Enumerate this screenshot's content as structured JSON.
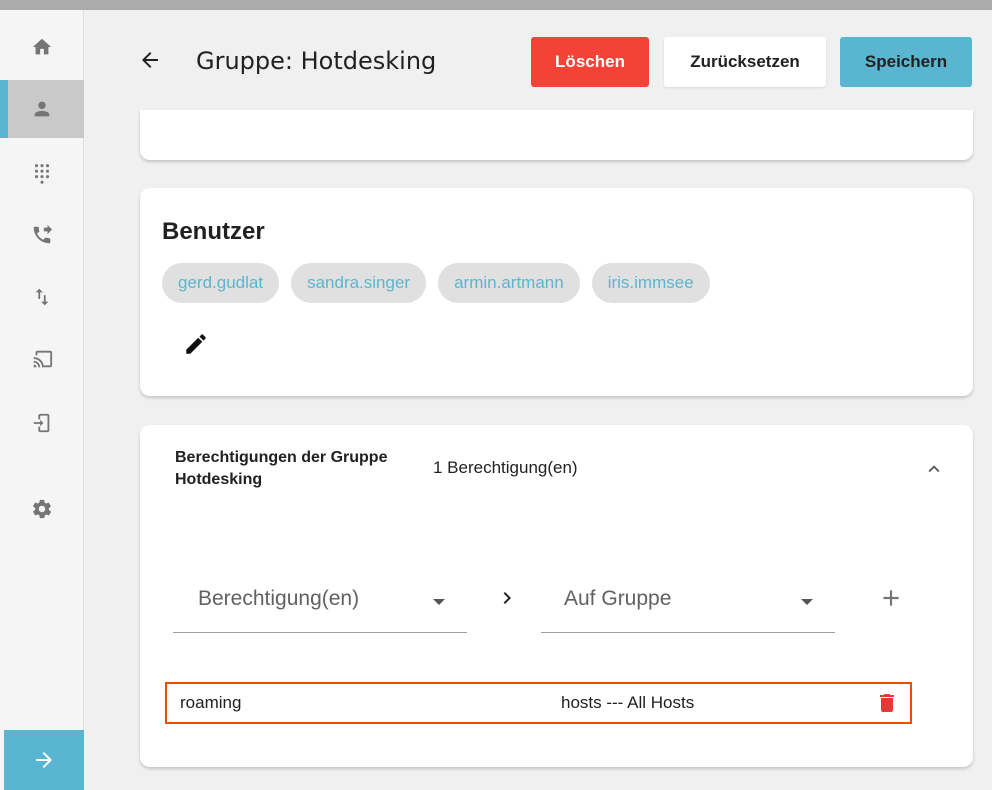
{
  "colors": {
    "accent": "#5ab6d0",
    "danger": "#f44336",
    "highlight": "#e65100"
  },
  "sidebar": {
    "items": [
      {
        "icon": "home-icon"
      },
      {
        "icon": "person-icon",
        "active": true
      },
      {
        "icon": "dialpad-icon"
      },
      {
        "icon": "phone-forward-icon"
      },
      {
        "icon": "swap-vert-icon"
      },
      {
        "icon": "cast-icon"
      },
      {
        "icon": "login-icon"
      },
      {
        "icon": "settings-icon"
      }
    ],
    "expand_icon": "arrow-right-icon"
  },
  "header": {
    "title": "Gruppe: Hotdesking",
    "delete_label": "Löschen",
    "reset_label": "Zurücksetzen",
    "save_label": "Speichern"
  },
  "users": {
    "title": "Benutzer",
    "chips": [
      "gerd.gudlat",
      "sandra.singer",
      "armin.artmann",
      "iris.immsee"
    ]
  },
  "permissions": {
    "title": "Berechtigungen der Gruppe Hotdesking",
    "count": "1 Berechtigung(en)",
    "permission_select": "Berechtigung(en)",
    "group_select": "Auf Gruppe",
    "rows": [
      {
        "name": "roaming",
        "target": "hosts --- All Hosts"
      }
    ]
  }
}
